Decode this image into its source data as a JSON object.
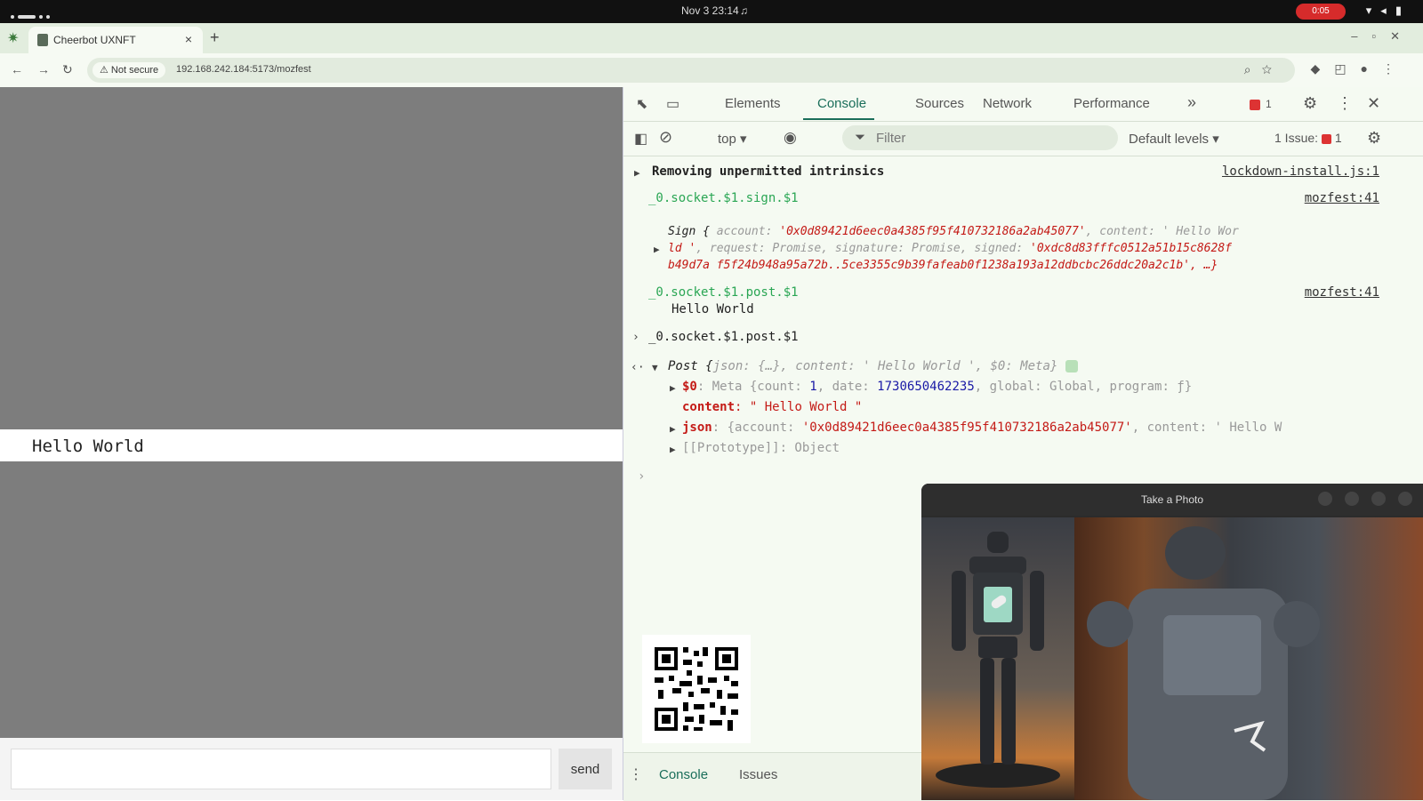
{
  "os_bar": {
    "clock": "Nov 3 23:14",
    "recording_label": "0:05"
  },
  "browser": {
    "tab_title": "Cheerbot UXNFT",
    "new_tab": "+",
    "close_tab": "×",
    "security_label": "Not secure",
    "url": "192.168.242.184:5173/mozfest"
  },
  "app": {
    "message": "Hello World",
    "send_label": "send",
    "input_value": ""
  },
  "devtools": {
    "tabs": [
      "Elements",
      "Console",
      "Sources",
      "Network",
      "Performance"
    ],
    "more_tabs": "»",
    "error_count": "1",
    "context": "top",
    "filter_placeholder": "Filter",
    "levels": "Default levels",
    "issues_label": "1 Issue:",
    "issues_count": "1",
    "drawer_tabs": [
      "Console",
      "Issues"
    ]
  },
  "console": {
    "l1_text": "Removing unpermitted intrinsics",
    "l1_src": "lockdown-install.js:1",
    "l2_label": "_0.socket.$1.sign.$1",
    "l2_src": "mozfest:41",
    "sign_line1a": "Sign {",
    "sign_line1b": "account: ",
    "sign_line1c": "'0x0d89421d6eec0a4385f95f410732186a2ab45077'",
    "sign_line1d": ", content: '   Hello Wor",
    "sign_line2a": "ld   '",
    "sign_line2b": ", request: Promise, signature: Promise, signed: ",
    "sign_line2c": "'0xdc8d83fffc0512a51b15c8628f",
    "sign_line3": "b49d7a f5f24b948a95a72b..5ce3355c9b39fafeab0f1238a193a12ddbcbc26ddc20a2c1b', …}",
    "l3_label": "_0.socket.$1.post.$1",
    "l3_src": "mozfest:41",
    "l3_value": "Hello World",
    "l4_input": "_0.socket.$1.post.$1",
    "post_a": "Post {",
    "post_b": "json: {…}, content: '   Hello World   ', $0: Meta}",
    "meta_key": "$0",
    "meta_a": ": Meta {count: ",
    "meta_count": "1",
    "meta_b": ", date: ",
    "meta_date": "1730650462235",
    "meta_c": ", global: Global, program: ƒ}",
    "content_key": "content",
    "content_val": ": \"   Hello World   \"",
    "json_key": "json",
    "json_a": ": {account: ",
    "json_acct": "'0x0d89421d6eec0a4385f95f410732186a2ab45077'",
    "json_b": ", content: '   Hello W",
    "proto": "[[Prototype]]: Object",
    "prompt": "›"
  },
  "photo_window": {
    "title": "Take a Photo"
  }
}
